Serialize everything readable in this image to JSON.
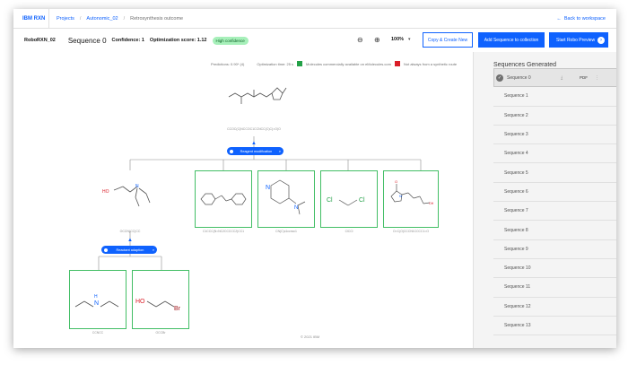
{
  "nav": {
    "brand": "IBM RXN",
    "crumbs": [
      "Projects",
      "Autonomic_02",
      "Retrosynthesis outcome"
    ],
    "back_label": "Back to workspace"
  },
  "toolbar": {
    "model": "RoboRXN_02",
    "sequence_title": "Sequence 0",
    "confidence": "Confidence: 1",
    "optimization": "Optimization score: 1.12",
    "badge": "High confidence",
    "zoom": "100%",
    "copy_button": "Copy & Create New",
    "add_button": "Add Sequence to collection",
    "start_button": "Start Robo Preview"
  },
  "canvas": {
    "legend_step": "Predictions: 0.90* (4)",
    "legend_opt": "Optimization time: 25 s",
    "legend_green": "Molecules commercially available on eMolecules.com",
    "legend_red": "Not always from a synthetic route",
    "target_label": "CCOC(C)NCCOC1CCNCC(C)C(=O)O",
    "reaction_1": "Reagent modification",
    "reaction_2": "Reactant adaption",
    "mid_label": "OCCN(CC)CC",
    "mol_labels": [
      "C1CCC(N=NC2CCCCC2)CC1",
      "CN(C)c1ccncc1",
      "ClCCl",
      "O=C(O)CCCN1CCCC1=O"
    ],
    "bottom_labels": [
      "CCNCC",
      "OCCBr"
    ],
    "footer": "© 2021 IBM"
  },
  "panel": {
    "title": "Sequences Generated",
    "pdf_label": "PDF",
    "sequences": [
      "Sequence 0",
      "Sequence 1",
      "Sequence 2",
      "Sequence 3",
      "Sequence 4",
      "Sequence 5",
      "Sequence 6",
      "Sequence 7",
      "Sequence 8",
      "Sequence 9",
      "Sequence 10",
      "Sequence 11",
      "Sequence 12",
      "Sequence 13"
    ]
  }
}
